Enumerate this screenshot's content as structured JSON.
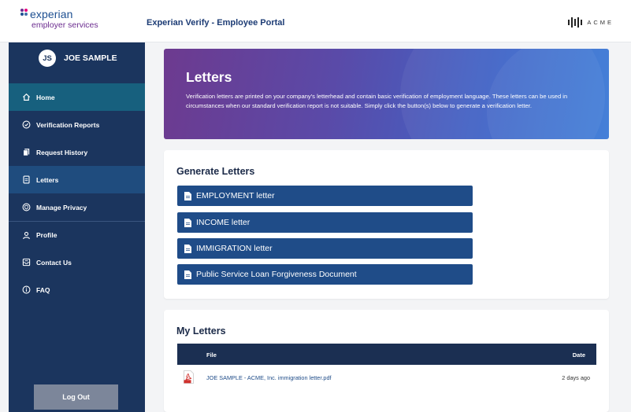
{
  "header": {
    "logo_word": "experian",
    "logo_sub": "employer services",
    "portal_title": "Experian Verify - Employee Portal",
    "brand": "ACME"
  },
  "sidebar": {
    "user_initials": "JS",
    "user_name": "JOE SAMPLE",
    "items": [
      {
        "label": "Home",
        "icon": "home-icon"
      },
      {
        "label": "Verification Reports",
        "icon": "check-shield-icon"
      },
      {
        "label": "Request History",
        "icon": "documents-icon"
      },
      {
        "label": "Letters",
        "icon": "letter-icon"
      },
      {
        "label": "Manage Privacy",
        "icon": "privacy-shield-icon"
      },
      {
        "label": "Profile",
        "icon": "person-icon"
      },
      {
        "label": "Contact Us",
        "icon": "contact-icon"
      },
      {
        "label": "FAQ",
        "icon": "info-icon"
      }
    ],
    "logout_label": "Log Out"
  },
  "hero": {
    "title": "Letters",
    "description": "Verification letters are printed on your company's letterhead and contain basic verification of employment language. These letters can be used in circumstances when our standard verification report is not suitable. Simply click the button(s) below to generate a verification letter."
  },
  "generate": {
    "title": "Generate Letters",
    "buttons": [
      "EMPLOYMENT letter",
      "INCOME letter",
      "IMMIGRATION letter",
      "Public Service Loan Forgiveness Document"
    ]
  },
  "my_letters": {
    "title": "My Letters",
    "columns": {
      "file": "File",
      "date": "Date"
    },
    "rows": [
      {
        "file": "JOE SAMPLE - ACME, Inc. immigration letter.pdf",
        "date": "2 days ago"
      }
    ]
  },
  "colors": {
    "sidebar_bg": "#1b355e",
    "active_nav": "#17607e",
    "button_bg": "#1f4c88",
    "hero_start": "#6d3a8f",
    "hero_end": "#3b7ad6"
  }
}
